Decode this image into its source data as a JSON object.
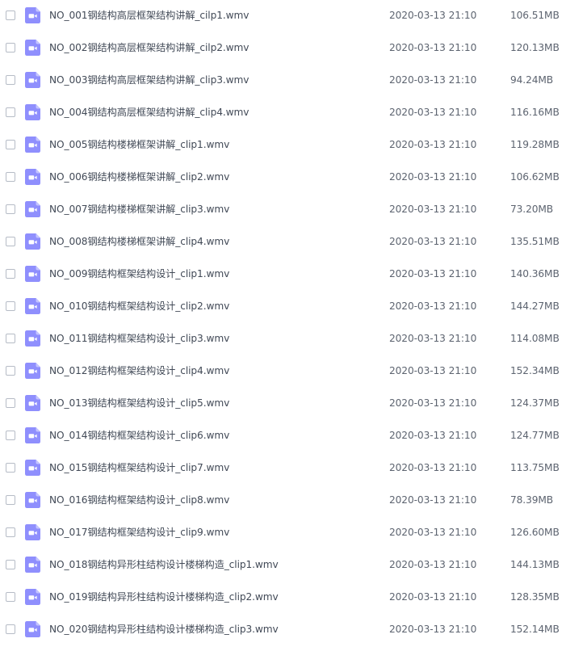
{
  "colors": {
    "icon_fill": "#8f8ffd",
    "icon_fold": "#c4c4ff",
    "icon_glyph": "#ffffff",
    "text": "#424a57",
    "meta_text": "#5d6470",
    "checkbox_border": "#b6bcc6"
  },
  "icons": {
    "file_type": "video-file-icon",
    "select": "checkbox"
  },
  "files": [
    {
      "name": "NO_001钢结构高层框架结构讲解_cilp1.wmv",
      "date": "2020-03-13 21:10",
      "size": "106.51MB"
    },
    {
      "name": "NO_002钢结构高层框架结构讲解_cilp2.wmv",
      "date": "2020-03-13 21:10",
      "size": "120.13MB"
    },
    {
      "name": "NO_003钢结构高层框架结构讲解_clip3.wmv",
      "date": "2020-03-13 21:10",
      "size": "94.24MB"
    },
    {
      "name": "NO_004钢结构高层框架结构讲解_clip4.wmv",
      "date": "2020-03-13 21:10",
      "size": "116.16MB"
    },
    {
      "name": "NO_005钢结构楼梯框架讲解_clip1.wmv",
      "date": "2020-03-13 21:10",
      "size": "119.28MB"
    },
    {
      "name": "NO_006钢结构楼梯框架讲解_clip2.wmv",
      "date": "2020-03-13 21:10",
      "size": "106.62MB"
    },
    {
      "name": "NO_007钢结构楼梯框架讲解_clip3.wmv",
      "date": "2020-03-13 21:10",
      "size": "73.20MB"
    },
    {
      "name": "NO_008钢结构楼梯框架讲解_clip4.wmv",
      "date": "2020-03-13 21:10",
      "size": "135.51MB"
    },
    {
      "name": "NO_009钢结构框架结构设计_clip1.wmv",
      "date": "2020-03-13 21:10",
      "size": "140.36MB"
    },
    {
      "name": "NO_010钢结构框架结构设计_clip2.wmv",
      "date": "2020-03-13 21:10",
      "size": "144.27MB"
    },
    {
      "name": "NO_011钢结构框架结构设计_clip3.wmv",
      "date": "2020-03-13 21:10",
      "size": "114.08MB"
    },
    {
      "name": "NO_012钢结构框架结构设计_clip4.wmv",
      "date": "2020-03-13 21:10",
      "size": "152.34MB"
    },
    {
      "name": "NO_013钢结构框架结构设计_clip5.wmv",
      "date": "2020-03-13 21:10",
      "size": "124.37MB"
    },
    {
      "name": "NO_014钢结构框架结构设计_clip6.wmv",
      "date": "2020-03-13 21:10",
      "size": "124.77MB"
    },
    {
      "name": "NO_015钢结构框架结构设计_clip7.wmv",
      "date": "2020-03-13 21:10",
      "size": "113.75MB"
    },
    {
      "name": "NO_016钢结构框架结构设计_clip8.wmv",
      "date": "2020-03-13 21:10",
      "size": "78.39MB"
    },
    {
      "name": "NO_017钢结构框架结构设计_clip9.wmv",
      "date": "2020-03-13 21:10",
      "size": "126.60MB"
    },
    {
      "name": "NO_018钢结构异形柱结构设计楼梯构造_clip1.wmv",
      "date": "2020-03-13 21:10",
      "size": "144.13MB"
    },
    {
      "name": "NO_019钢结构异形柱结构设计楼梯构造_clip2.wmv",
      "date": "2020-03-13 21:10",
      "size": "128.35MB"
    },
    {
      "name": "NO_020钢结构异形柱结构设计楼梯构造_clip3.wmv",
      "date": "2020-03-13 21:10",
      "size": "152.14MB"
    }
  ]
}
